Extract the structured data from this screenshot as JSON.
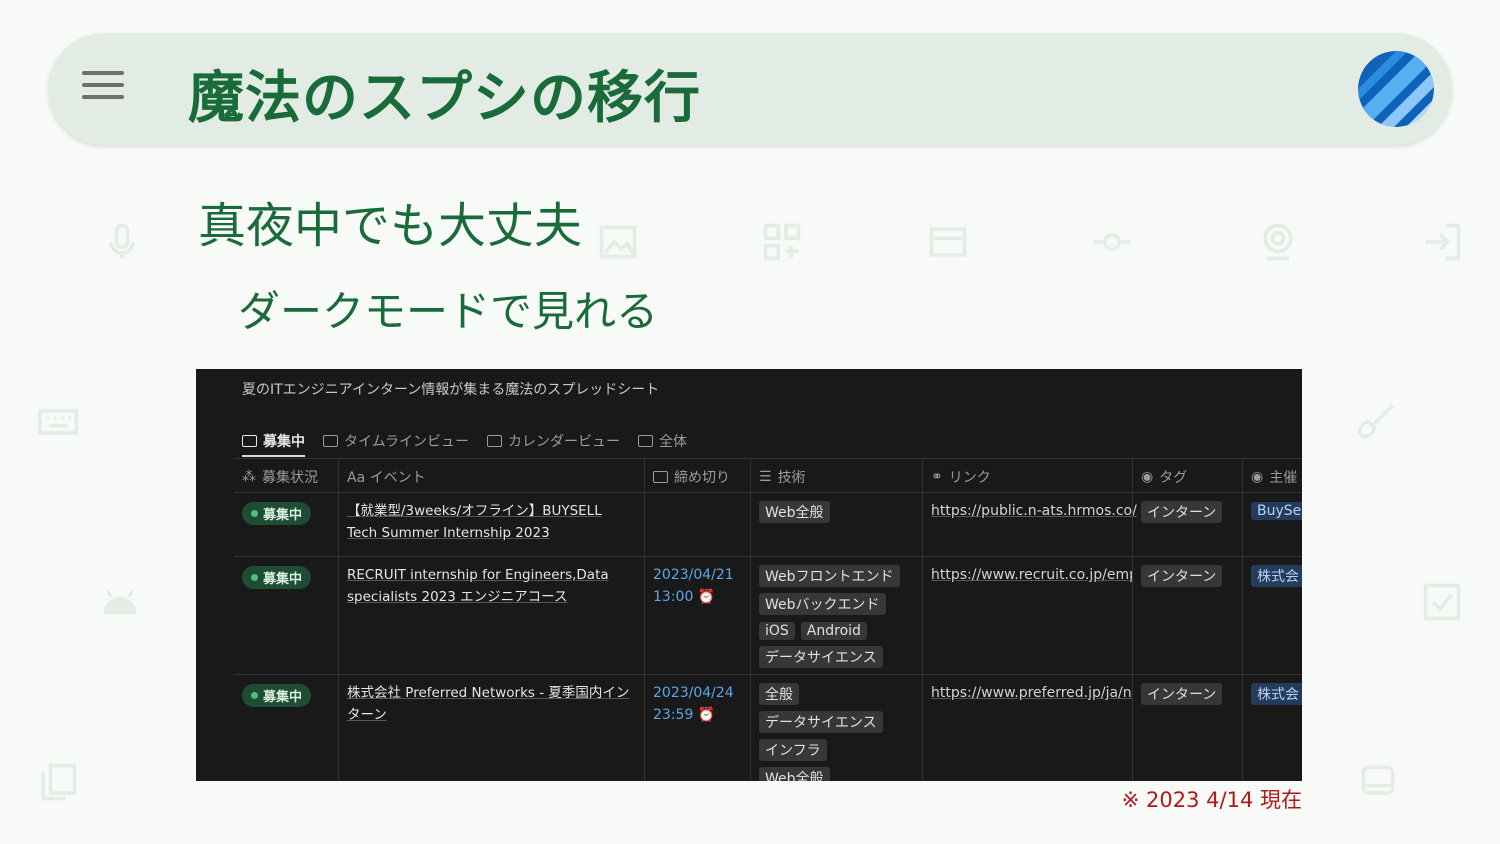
{
  "header": {
    "menu_icon": "hamburger-menu-icon",
    "title": "魔法のスプシの移行",
    "avatar_icon": "blue-striped-avatar"
  },
  "slide": {
    "subtitle": "真夜中でも大丈夫",
    "point": "ダークモードで見れる",
    "footnote": "※ 2023 4/14 現在"
  },
  "screenshot": {
    "page_title": "夏のITエンジニアインターン情報が集まる魔法のスプレッドシート",
    "views": [
      "募集中",
      "タイムラインビュー",
      "カレンダービュー",
      "全体"
    ],
    "columns": [
      "募集状況",
      "Aa イベント",
      "締め切り",
      "技術",
      "リンク",
      "タグ",
      "主催"
    ],
    "rows": [
      {
        "status": "募集中",
        "event": "【就業型/3weeks/オフライン】BUYSELL Tech Summer Internship 2023",
        "deadline_date": "",
        "deadline_time": "",
        "tech": [
          "Web全般"
        ],
        "link": "https://public.n-ats.hrmos.co/",
        "tag": "インターン",
        "host": "BuySe"
      },
      {
        "status": "募集中",
        "event": "RECRUIT internship for Engineers,Data specialists 2023 エンジニアコース",
        "deadline_date": "2023/04/21",
        "deadline_time": "13:00",
        "tech": [
          "Webフロントエンド",
          "Webバックエンド",
          "iOS",
          "Android",
          "データサイエンス"
        ],
        "link": "https://www.recruit.co.jp/emp",
        "tag": "インターン",
        "host": "株式会"
      },
      {
        "status": "募集中",
        "event": "株式会社 Preferred Networks - 夏季国内インターン",
        "deadline_date": "2023/04/24",
        "deadline_time": "23:59",
        "tech": [
          "全般",
          "データサイエンス",
          "インフラ",
          "Web全般"
        ],
        "link": "https://www.preferred.jp/ja/ne",
        "tag": "インターン",
        "host": "株式会"
      }
    ]
  },
  "colors": {
    "header_bg": "#e2ece4",
    "title_green": "#1a6b3a",
    "note_red": "#b21818",
    "dark_bg": "#191919",
    "status_green": "#4fbf7e",
    "date_blue": "#5aa7e8"
  }
}
